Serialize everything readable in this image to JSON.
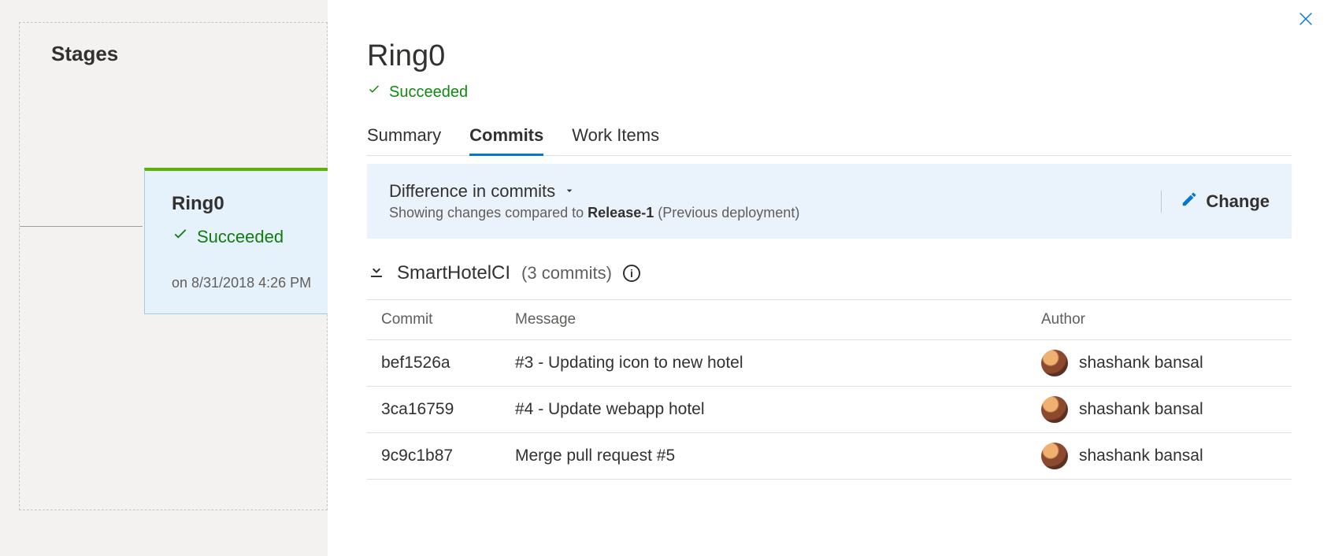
{
  "left": {
    "title": "Stages",
    "stage": {
      "name": "Ring0",
      "status_label": "Succeeded",
      "date": "on 8/31/2018 4:26 PM"
    }
  },
  "panel": {
    "title": "Ring0",
    "status_label": "Succeeded",
    "tabs": {
      "summary": "Summary",
      "commits": "Commits",
      "workitems": "Work Items"
    },
    "diff": {
      "title": "Difference in commits",
      "sub_pre": "Showing changes compared to ",
      "release": "Release-1",
      "sub_post": " (Previous deployment)",
      "change_label": "Change"
    },
    "artifact": {
      "name": "SmartHotelCI",
      "count": "(3 commits)"
    },
    "columns": {
      "commit": "Commit",
      "message": "Message",
      "author": "Author"
    },
    "commits": [
      {
        "id": "bef1526a",
        "message": "#3 - Updating icon to new hotel",
        "author": "shashank bansal"
      },
      {
        "id": "3ca16759",
        "message": "#4 - Update webapp hotel",
        "author": "shashank bansal"
      },
      {
        "id": "9c9c1b87",
        "message": "Merge pull request #5",
        "author": "shashank bansal"
      }
    ]
  }
}
